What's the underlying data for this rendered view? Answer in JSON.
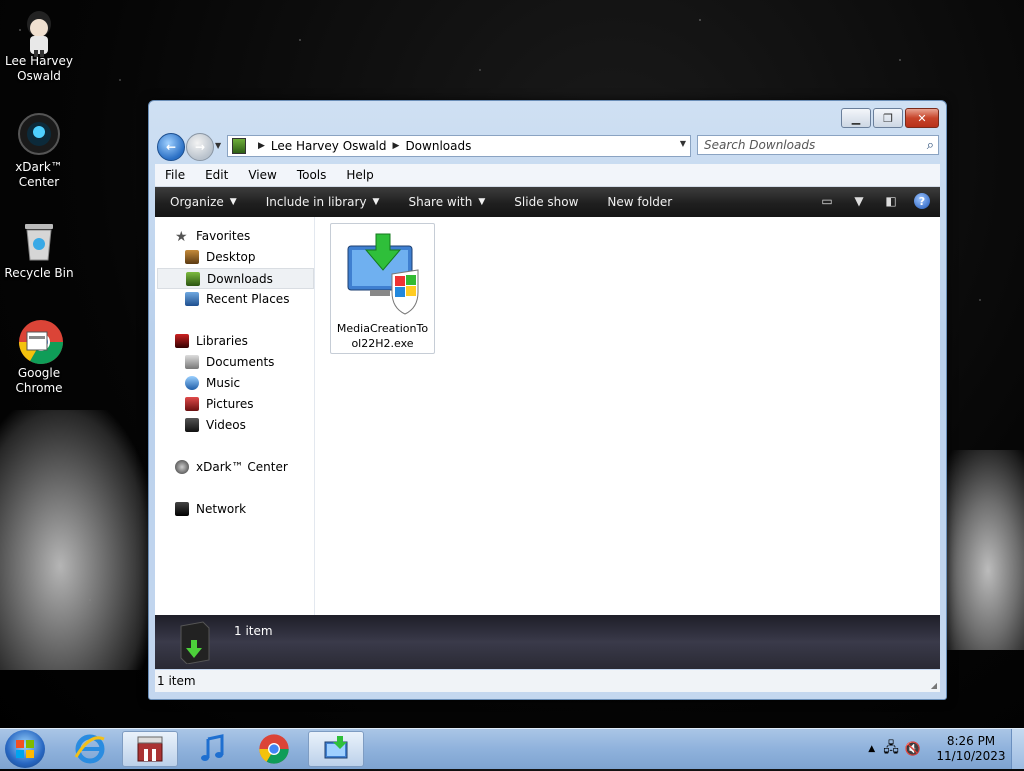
{
  "desktop": {
    "icons": [
      {
        "label_line1": "Lee Harvey",
        "label_line2": "Oswald",
        "icon": "user-folder-icon"
      },
      {
        "label_line1": "xDark™",
        "label_line2": "Center",
        "icon": "xdark-center-icon"
      },
      {
        "label_line1": "Recycle Bin",
        "label_line2": "",
        "icon": "recycle-bin-icon"
      },
      {
        "label_line1": "Google",
        "label_line2": "Chrome",
        "icon": "chrome-icon"
      }
    ]
  },
  "window": {
    "breadcrumb": [
      "Lee Harvey Oswald",
      "Downloads"
    ],
    "search_placeholder": "Search Downloads",
    "menu": [
      "File",
      "Edit",
      "View",
      "Tools",
      "Help"
    ],
    "toolbar": {
      "organize": "Organize",
      "include_in_library": "Include in library",
      "share_with": "Share with",
      "slide_show": "Slide show",
      "new_folder": "New folder"
    },
    "nav": {
      "favorites": "Favorites",
      "desktop": "Desktop",
      "downloads": "Downloads",
      "recent_places": "Recent Places",
      "libraries": "Libraries",
      "documents": "Documents",
      "music": "Music",
      "pictures": "Pictures",
      "videos": "Videos",
      "xdark_center": "xDark™ Center",
      "network": "Network"
    },
    "files": [
      {
        "name_line1": "MediaCreationTo",
        "name_line2": "ol22H2.exe",
        "icon": "installer-icon"
      }
    ],
    "details_count": "1 item",
    "status_text": "1 item"
  },
  "taskbar": {
    "time": "8:26 PM",
    "date": "11/10/2023"
  }
}
